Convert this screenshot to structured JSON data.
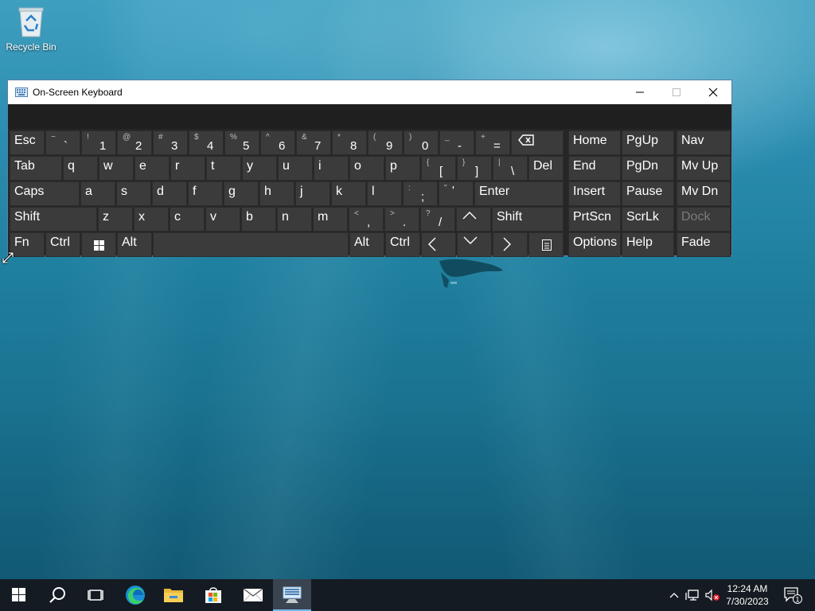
{
  "desktop": {
    "recycle_bin_label": "Recycle Bin"
  },
  "window": {
    "title": "On-Screen Keyboard",
    "icon": "keyboard-icon",
    "controls": [
      "minimize-icon",
      "maximize-icon",
      "close-icon"
    ]
  },
  "keys": {
    "esc": "Esc",
    "tilde": {
      "shift": "~",
      "main": "`"
    },
    "n1": {
      "shift": "!",
      "main": "1"
    },
    "n2": {
      "shift": "@",
      "main": "2"
    },
    "n3": {
      "shift": "#",
      "main": "3"
    },
    "n4": {
      "shift": "$",
      "main": "4"
    },
    "n5": {
      "shift": "%",
      "main": "5"
    },
    "n6": {
      "shift": "^",
      "main": "6"
    },
    "n7": {
      "shift": "&",
      "main": "7"
    },
    "n8": {
      "shift": "*",
      "main": "8"
    },
    "n9": {
      "shift": "(",
      "main": "9"
    },
    "n0": {
      "shift": ")",
      "main": "0"
    },
    "minus": {
      "shift": "_",
      "main": "-"
    },
    "equals": {
      "shift": "+",
      "main": "="
    },
    "tab": "Tab",
    "q": "q",
    "w": "w",
    "e": "e",
    "r": "r",
    "t": "t",
    "y": "y",
    "u": "u",
    "i": "i",
    "o": "o",
    "p": "p",
    "lbracket": {
      "shift": "{",
      "main": "["
    },
    "rbracket": {
      "shift": "}",
      "main": "]"
    },
    "backslash": {
      "shift": "|",
      "main": "\\"
    },
    "del": "Del",
    "caps": "Caps",
    "a": "a",
    "s": "s",
    "d": "d",
    "f": "f",
    "g": "g",
    "h": "h",
    "j": "j",
    "k": "k",
    "l": "l",
    "semicolon": {
      "shift": ":",
      "main": ";"
    },
    "quote": {
      "shift": "\"",
      "main": "'"
    },
    "enter": "Enter",
    "lshift": "Shift",
    "z": "z",
    "x": "x",
    "c": "c",
    "v": "v",
    "b": "b",
    "n": "n",
    "m": "m",
    "comma": {
      "shift": "<",
      "main": ","
    },
    "period": {
      "shift": ">",
      "main": "."
    },
    "slash": {
      "shift": "?",
      "main": "/"
    },
    "rshift": "Shift",
    "fn": "Fn",
    "ctrl": "Ctrl",
    "alt": "Alt",
    "ralt": "Alt",
    "rctrl": "Ctrl",
    "home": "Home",
    "pgup": "PgUp",
    "nav": "Nav",
    "end": "End",
    "pgdn": "PgDn",
    "mvup": "Mv Up",
    "insert": "Insert",
    "pause": "Pause",
    "mvdn": "Mv Dn",
    "prtscn": "PrtScn",
    "scrlk": "ScrLk",
    "dock": "Dock",
    "options": "Options",
    "help": "Help",
    "fade": "Fade"
  },
  "taskbar": {
    "items": [
      "windows-start-icon",
      "search-icon",
      "task-view-icon",
      "edge-icon",
      "file-explorer-icon",
      "store-icon",
      "mail-icon",
      "on-screen-keyboard-icon"
    ],
    "time": "12:24 AM",
    "date": "7/30/2023",
    "notification_count": "1"
  },
  "colors": {
    "key_bg": "#3b3b3b",
    "window_bg": "#262626",
    "taskbar_bg": "#141b22",
    "accent": "#76b9ed"
  }
}
